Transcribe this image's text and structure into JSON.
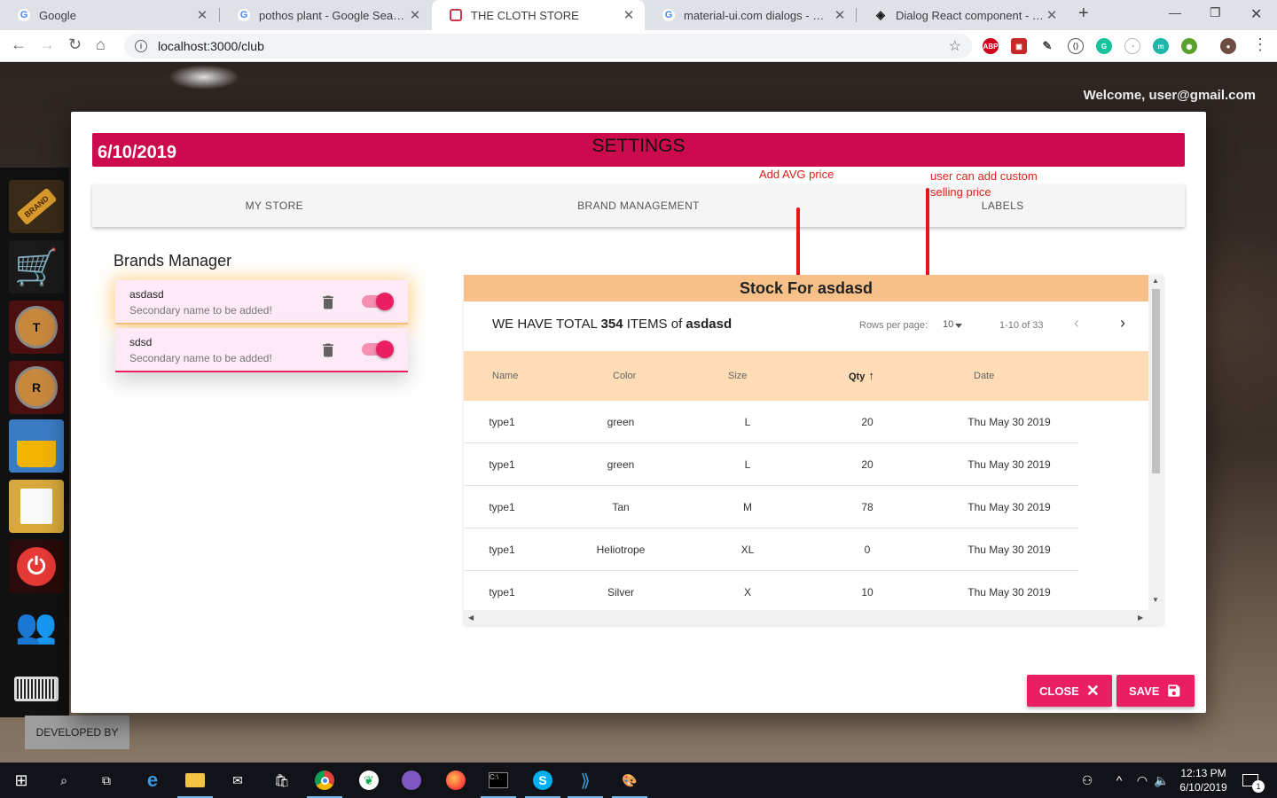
{
  "browser": {
    "tabs": [
      {
        "title": "Google",
        "favicon": "google-g"
      },
      {
        "title": "pothos plant - Google Search",
        "favicon": "google-g"
      },
      {
        "title": "THE CLOTH STORE",
        "favicon": "store"
      },
      {
        "title": "material-ui.com dialogs - Google Search",
        "favicon": "google-g"
      },
      {
        "title": "Dialog React component - Material-UI",
        "favicon": "mui"
      }
    ],
    "url": "localhost:3000/club"
  },
  "app": {
    "welcome": "Welcome, user@gmail.com",
    "developed_by": "DEVELOPED BY",
    "sidebar": [
      {
        "name": "brand-icon",
        "label": "BRAND"
      },
      {
        "name": "cart-icon",
        "label": ""
      },
      {
        "name": "t-icon",
        "label": "T"
      },
      {
        "name": "r-icon",
        "label": "R"
      },
      {
        "name": "basket-icon",
        "label": ""
      },
      {
        "name": "report-icon",
        "label": ""
      },
      {
        "name": "power-icon",
        "label": ""
      },
      {
        "name": "users-icon",
        "label": ""
      },
      {
        "name": "barcode-icon",
        "label": ""
      }
    ]
  },
  "dialog": {
    "date": "6/10/2019",
    "title": "SETTINGS",
    "tabs": [
      "MY STORE",
      "BRAND MANAGEMENT",
      "LABELS"
    ],
    "annotations": {
      "avg_price": "Add AVG price",
      "custom_price_line1": "user can add custom",
      "custom_price_line2": "selling price"
    },
    "brands": {
      "title": "Brands Manager",
      "items": [
        {
          "name": "asdasd",
          "secondary": "Secondary name to be added!",
          "enabled": true
        },
        {
          "name": "sdsd",
          "secondary": "Secondary name to be added!",
          "enabled": true
        }
      ]
    },
    "stock": {
      "heading": "Stock For asdasd",
      "total_prefix": "WE HAVE TOTAL ",
      "total_count": "354",
      "total_mid": " ITEMS of ",
      "total_brand": "asdasd",
      "rows_per_page_label": "Rows per page:",
      "rows_per_page": "10",
      "range": "1-10 of 33",
      "columns": [
        "Name",
        "Color",
        "Size",
        "Qty",
        "Date"
      ],
      "rows": [
        [
          "type1",
          "green",
          "L",
          "20",
          "Thu May 30 2019"
        ],
        [
          "type1",
          "green",
          "L",
          "20",
          "Thu May 30 2019"
        ],
        [
          "type1",
          "Tan",
          "M",
          "78",
          "Thu May 30 2019"
        ],
        [
          "type1",
          "Heliotrope",
          "XL",
          "0",
          "Thu May 30 2019"
        ],
        [
          "type1",
          "Silver",
          "X",
          "10",
          "Thu May 30 2019"
        ]
      ]
    },
    "buttons": {
      "close": "CLOSE",
      "save": "SAVE"
    }
  },
  "taskbar": {
    "time": "12:13 PM",
    "date": "6/10/2019",
    "notification_count": "1"
  },
  "colors": {
    "header_bg": "#cc0a4e",
    "accent": "#e91e63",
    "stock_head": "#f7c088",
    "table_head": "#fddcb6",
    "annotation": "#e0201a"
  }
}
